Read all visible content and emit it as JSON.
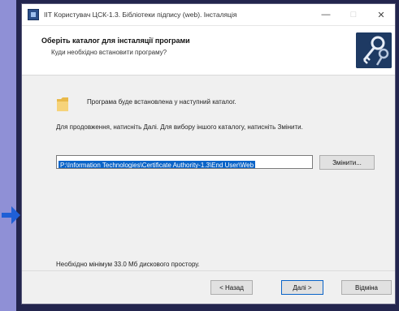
{
  "window": {
    "title": "ІІТ Користувач ЦСК-1.3. Бібліотеки підпису (web). Інсталяція",
    "minimize_glyph": "—",
    "maximize_glyph": "□",
    "close_glyph": "✕"
  },
  "header": {
    "title": "Оберіть каталог для інсталяції програми",
    "subtitle": "Куди необхідно встановити програму?",
    "icon": "keys-icon"
  },
  "content": {
    "folder_icon": "folder-icon",
    "info_text": "Програма буде встановлена у наступний каталог.",
    "instruction_text": "Для продовження, натисніть Далі. Для вибору іншого каталогу, натисніть Змінити.",
    "install_path": "P:\\Information Technologies\\Certificate Authority-1.3\\End User\\Web",
    "browse_label": "Змінити...",
    "disk_space_text": "Необхідно мінімум 33.0 Мб дискового простору."
  },
  "footer": {
    "back_label": "< Назад",
    "next_label": "Далі >",
    "cancel_label": "Відміна"
  },
  "colors": {
    "accent": "#0a64c8",
    "background": "#8f90d6",
    "frame": "#23254e",
    "arrow": "#1f5fd6"
  }
}
